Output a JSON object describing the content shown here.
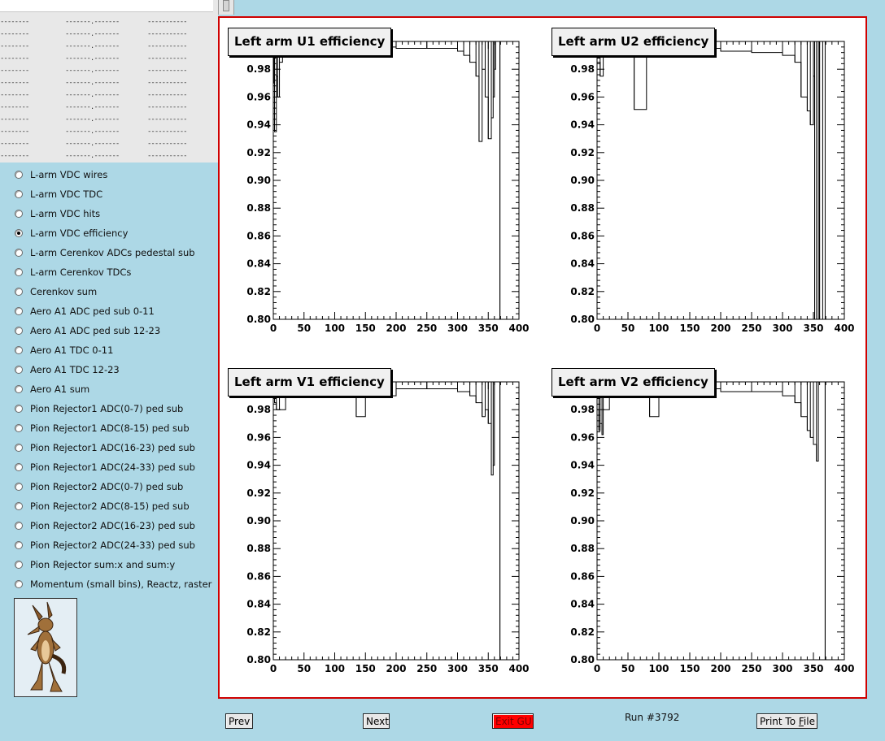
{
  "stats": {
    "rows": [
      [
        "--------",
        "-------.-------",
        "-----------"
      ],
      [
        "--------",
        "-------.-------",
        "-----------"
      ],
      [
        "--------",
        "-------.-------",
        "-----------"
      ],
      [
        "--------",
        "-------.-------",
        "-----------"
      ],
      [
        "--------",
        "-------.-------",
        "-----------"
      ],
      [
        "--------",
        "-------.-------",
        "-----------"
      ],
      [
        "--------",
        "-------.-------",
        "-----------"
      ],
      [
        "--------",
        "-------.-------",
        "-----------"
      ],
      [
        "--------",
        "-------.-------",
        "-----------"
      ],
      [
        "--------",
        "-------.-------",
        "-----------"
      ],
      [
        "--------",
        "-------.-------",
        "-----------"
      ],
      [
        "--------",
        "-------.-------",
        "-----------"
      ]
    ]
  },
  "menu": {
    "selected": 3,
    "items": [
      "L-arm VDC wires",
      "L-arm VDC TDC",
      "L-arm VDC hits",
      "L-arm VDC efficiency",
      "L-arm Cerenkov ADCs pedestal sub",
      "L-arm Cerenkov TDCs",
      "Cerenkov sum",
      "Aero A1 ADC ped sub 0-11",
      "Aero A1 ADC ped sub 12-23",
      "Aero A1 TDC 0-11",
      "Aero A1 TDC 12-23",
      "Aero A1 sum",
      "Pion Rejector1 ADC(0-7) ped sub",
      "Pion Rejector1 ADC(8-15) ped sub",
      "Pion Rejector1 ADC(16-23) ped sub",
      "Pion Rejector1 ADC(24-33) ped sub",
      "Pion Rejector2 ADC(0-7) ped sub",
      "Pion Rejector2 ADC(8-15) ped sub",
      "Pion Rejector2 ADC(16-23) ped sub",
      "Pion Rejector2 ADC(24-33) ped sub",
      "Pion Rejector sum:x and sum:y",
      "Momentum (small bins), Reactz, raster"
    ]
  },
  "logo": {
    "icon": "cartoon-coyote-icon"
  },
  "colors": {
    "background": "#add8e6",
    "frame": "#d00000",
    "exit": "#ff0000"
  },
  "chart_data": [
    {
      "type": "bar",
      "title": "Left arm U1 efficiency",
      "xlim": [
        0,
        400
      ],
      "ylim": [
        0.8,
        1.0
      ],
      "xticks": [
        "0",
        "50",
        "100",
        "150",
        "200",
        "250",
        "300",
        "350",
        "400"
      ],
      "yticks": [
        "0.80",
        "0.82",
        "0.84",
        "0.86",
        "0.88",
        "0.90",
        "0.92",
        "0.94",
        "0.96",
        "0.98"
      ],
      "x": [
        0,
        1,
        2,
        5,
        7,
        10,
        15,
        20,
        40,
        75,
        100,
        150,
        200,
        250,
        300,
        310,
        320,
        330,
        335,
        340,
        345,
        350,
        355,
        358,
        360,
        362,
        365,
        368,
        369
      ],
      "y": [
        0.99,
        0.97,
        0.935,
        0.975,
        0.96,
        0.985,
        0.99,
        0.99,
        0.99,
        0.995,
        0.995,
        0.996,
        0.995,
        0.995,
        0.993,
        0.99,
        0.985,
        0.975,
        0.928,
        0.98,
        0.96,
        0.93,
        0.945,
        0.96,
        0.98,
        1.0,
        1.0,
        1.0,
        0.8
      ]
    },
    {
      "type": "bar",
      "title": "Left arm U2 efficiency",
      "xlim": [
        0,
        400
      ],
      "ylim": [
        0.8,
        1.0
      ],
      "xticks": [
        "0",
        "50",
        "100",
        "150",
        "200",
        "250",
        "300",
        "350",
        "400"
      ],
      "yticks": [
        "0.80",
        "0.82",
        "0.84",
        "0.86",
        "0.88",
        "0.90",
        "0.92",
        "0.94",
        "0.96",
        "0.98"
      ],
      "x": [
        0,
        5,
        10,
        20,
        40,
        60,
        80,
        100,
        150,
        200,
        250,
        300,
        320,
        330,
        340,
        345,
        350,
        352,
        355,
        358,
        360,
        365,
        368
      ],
      "y": [
        0.985,
        0.975,
        0.99,
        0.99,
        0.993,
        0.951,
        0.99,
        0.99,
        0.995,
        0.993,
        0.992,
        0.99,
        0.985,
        0.96,
        0.95,
        0.94,
        0.975,
        0.8,
        0.8,
        1.0,
        0.8,
        1.0,
        1.0
      ]
    },
    {
      "type": "bar",
      "title": "Left arm V1 efficiency",
      "xlim": [
        0,
        400
      ],
      "ylim": [
        0.8,
        1.0
      ],
      "xticks": [
        "0",
        "50",
        "100",
        "150",
        "200",
        "250",
        "300",
        "350",
        "400"
      ],
      "yticks": [
        "0.80",
        "0.82",
        "0.84",
        "0.86",
        "0.88",
        "0.90",
        "0.92",
        "0.94",
        "0.96",
        "0.98"
      ],
      "x": [
        0,
        2,
        5,
        10,
        20,
        60,
        100,
        135,
        150,
        200,
        250,
        300,
        320,
        330,
        340,
        345,
        350,
        355,
        358,
        360,
        365,
        368,
        369
      ],
      "y": [
        0.99,
        0.985,
        0.98,
        0.98,
        0.99,
        0.99,
        0.99,
        0.975,
        0.99,
        0.995,
        0.995,
        0.993,
        0.99,
        0.985,
        0.975,
        0.98,
        0.97,
        0.933,
        0.94,
        1.0,
        1.0,
        1.0,
        0.8
      ]
    },
    {
      "type": "bar",
      "title": "Left arm V2 efficiency",
      "xlim": [
        0,
        400
      ],
      "ylim": [
        0.8,
        1.0
      ],
      "xticks": [
        "0",
        "50",
        "100",
        "150",
        "200",
        "250",
        "300",
        "350",
        "400"
      ],
      "yticks": [
        "0.80",
        "0.82",
        "0.84",
        "0.86",
        "0.88",
        "0.90",
        "0.92",
        "0.94",
        "0.96",
        "0.98"
      ],
      "x": [
        0,
        3,
        5,
        8,
        10,
        20,
        40,
        60,
        85,
        100,
        150,
        200,
        250,
        300,
        320,
        330,
        340,
        345,
        350,
        355,
        358,
        360,
        365,
        368,
        369
      ],
      "y": [
        0.98,
        0.965,
        0.97,
        0.962,
        0.98,
        0.99,
        0.99,
        0.99,
        0.975,
        0.99,
        0.995,
        0.993,
        0.993,
        0.99,
        0.985,
        0.975,
        0.965,
        0.96,
        0.955,
        0.943,
        1.0,
        1.0,
        1.0,
        1.0,
        0.8
      ]
    }
  ],
  "buttons": {
    "prev": "Prev",
    "next": "Next",
    "exit": "Exit GUI",
    "print_prefix": "Print To ",
    "print_key": "F",
    "print_suffix": "ile"
  },
  "run_label": "Run #3792"
}
